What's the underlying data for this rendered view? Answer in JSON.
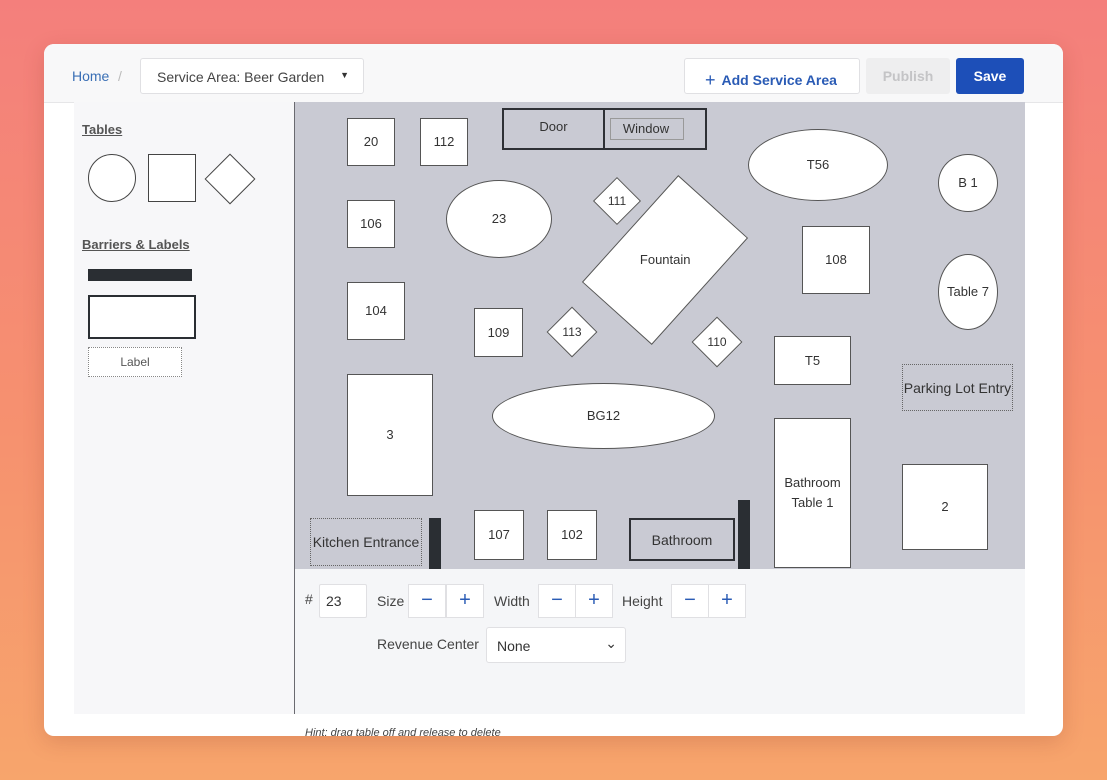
{
  "breadcrumb": {
    "home": "Home",
    "separator": "/"
  },
  "area_select": {
    "value": "Service Area: Beer Garden",
    "caret_icon": "caret-down-icon"
  },
  "toolbar": {
    "add_label": "Add Service Area",
    "add_icon": "plus-icon",
    "publish_label": "Publish",
    "save_label": "Save"
  },
  "sidebar": {
    "tables_heading": "Tables",
    "barriers_heading": "Barriers & Labels",
    "label_item": "Label"
  },
  "floor": {
    "t20": "20",
    "t112": "112",
    "door": "Door",
    "window": "Window",
    "t56": "T56",
    "b1": "B 1",
    "t106": "106",
    "t23": "23",
    "t111": "111",
    "fountain": "Fountain",
    "t108": "108",
    "table7": "Table 7",
    "t104": "104",
    "t109": "109",
    "t113": "113",
    "t110": "110",
    "t5": "T5",
    "parking": "Parking Lot Entry",
    "t3": "3",
    "bg12": "BG12",
    "bathroom_table": "Bathroom Table 1",
    "t2": "2",
    "kitchen": "Kitchen Entrance",
    "t107": "107",
    "t102": "102",
    "bathroom": "Bathroom"
  },
  "properties": {
    "number_label": "#",
    "number_value": "23",
    "size_label": "Size",
    "width_label": "Width",
    "height_label": "Height",
    "minus": "−",
    "plus": "+",
    "revenue_label": "Revenue Center",
    "revenue_value": "None",
    "hint": "Hint: drag table off and release to delete"
  },
  "colors": {
    "accent": "#1d4fb8",
    "canvas": "#c9cad3",
    "barrier": "#2a2e33"
  }
}
